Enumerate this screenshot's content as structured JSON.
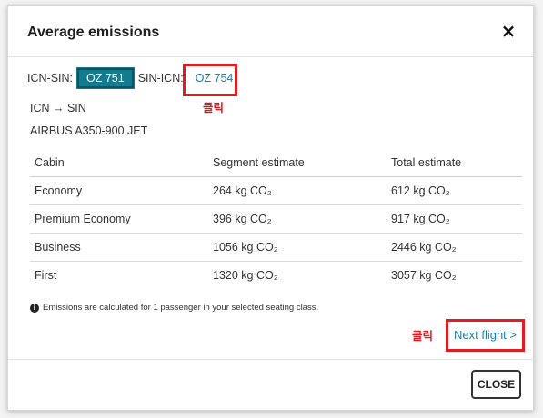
{
  "dialog": {
    "title": "Average emissions",
    "close_icon": "×"
  },
  "flights": {
    "outbound_label": "ICN-SIN:",
    "outbound_flight": "OZ 751",
    "return_label": "SIN-ICN:",
    "return_flight": "OZ 754",
    "annotation_1": "클릭"
  },
  "route": {
    "text": "ICN → SIN",
    "aircraft": "AIRBUS A350-900 JET"
  },
  "table": {
    "headers": [
      "Cabin",
      "Segment estimate",
      "Total estimate"
    ],
    "rows": [
      [
        "Economy",
        "264 kg CO₂",
        "612 kg CO₂"
      ],
      [
        "Premium Economy",
        "396 kg CO₂",
        "917 kg CO₂"
      ],
      [
        "Business",
        "1056 kg CO₂",
        "2446 kg CO₂"
      ],
      [
        "First",
        "1320 kg CO₂",
        "3057 kg CO₂"
      ]
    ]
  },
  "info": {
    "icon": "info-icon",
    "text": "Emissions are calculated for 1 passenger in your selected seating class."
  },
  "next": {
    "annotation_2": "클릭",
    "label": "Next flight >"
  },
  "footer": {
    "close_label": "CLOSE"
  },
  "colors": {
    "accent": "#137a8f",
    "link": "#1d7fa3",
    "annotation_red": "#e31b23"
  }
}
